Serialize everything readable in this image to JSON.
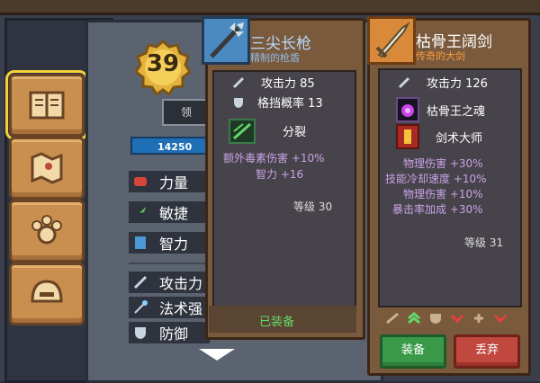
{
  "player": {
    "level": "39",
    "name_abbrev": "领",
    "hp_text": "14250"
  },
  "stats": [
    {
      "label": "力量",
      "icon": "fist-icon"
    },
    {
      "label": "敏捷",
      "icon": "feather-icon"
    },
    {
      "label": "智力",
      "icon": "book-icon"
    }
  ],
  "combat_stats": [
    {
      "label": "攻击力",
      "icon": "sword-icon"
    },
    {
      "label": "法术强",
      "icon": "wand-icon"
    },
    {
      "label": "防御",
      "icon": "shield-icon"
    }
  ],
  "nav": [
    "book-icon",
    "map-icon",
    "paw-icon",
    "helmet-icon"
  ],
  "item1": {
    "name": "三尖长枪",
    "subtitle": "精制的枪盾",
    "attack": "攻击力 85",
    "block": "格挡概率 13",
    "skill": "分裂",
    "bonus1": "额外毒素伤害 +10%",
    "bonus2": "智力 +16",
    "level": "等级 30",
    "status": "已装备"
  },
  "item2": {
    "name": "枯骨王阔剑",
    "subtitle": "传奇的大剑",
    "attack": "攻击力 126",
    "gem": "枯骨王之魂",
    "skill": "剑术大师",
    "bonus1": "物理伤害 +30%",
    "bonus2": "技能冷却速度 +10%",
    "bonus3": "物理伤害 +10%",
    "bonus4": "暴击率加成 +30%",
    "level": "等级 31",
    "equip_label": "装备",
    "discard_label": "丢弃"
  },
  "colors": {
    "accent": "#c98f4e",
    "panel": "#47434a",
    "equip": "#3a9a4a",
    "discard": "#c0483e"
  }
}
